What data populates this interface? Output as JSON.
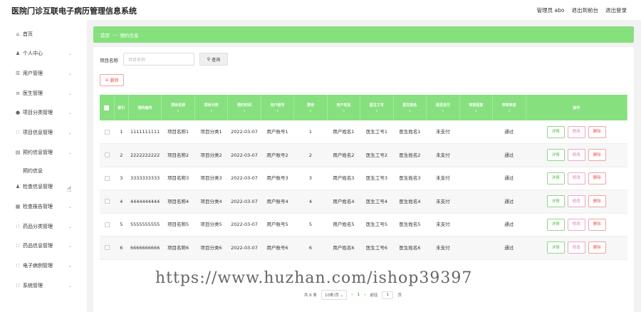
{
  "app": {
    "title": "医院门诊互联电子病历管理信息系统"
  },
  "topnav": {
    "user": "管理员 abo",
    "backend": "退出到前台",
    "logout": "退出登录"
  },
  "sidebar": {
    "items": [
      {
        "icon": "home-icon",
        "glyph": "⌂",
        "label": "首页",
        "arrow": false
      },
      {
        "icon": "user-icon",
        "glyph": "♟",
        "label": "个人中心",
        "arrow": true
      },
      {
        "icon": "users-icon",
        "glyph": "☰",
        "label": "用户管理",
        "arrow": true
      },
      {
        "icon": "doctor-icon",
        "glyph": "≡",
        "label": "医生管理",
        "arrow": true
      },
      {
        "icon": "category-icon",
        "glyph": "●",
        "label": "项目分类管理",
        "arrow": true
      },
      {
        "icon": "grid-icon",
        "glyph": "∷",
        "label": "项目信息管理",
        "arrow": true
      },
      {
        "icon": "calendar-icon",
        "glyph": "▤",
        "label": "预约信息管理",
        "arrow": true
      },
      {
        "icon": "exam-icon",
        "glyph": "♟",
        "label": "检查信息管理",
        "arrow": true
      },
      {
        "icon": "report-icon",
        "glyph": "▦",
        "label": "检查报告管理",
        "arrow": true
      },
      {
        "icon": "drug-category-icon",
        "glyph": "∷",
        "label": "药品分类管理",
        "arrow": true
      },
      {
        "icon": "drug-info-icon",
        "glyph": "∷",
        "label": "药品信息管理",
        "arrow": true
      },
      {
        "icon": "record-icon",
        "glyph": "∷",
        "label": "电子病例管理",
        "arrow": true
      },
      {
        "icon": "system-icon",
        "glyph": "∷",
        "label": "系统管理",
        "arrow": true
      }
    ],
    "sub_item": "预约信息"
  },
  "breadcrumb": {
    "home": "首页",
    "sep": "—",
    "current": "预约信息"
  },
  "search": {
    "label": "项目名称",
    "placeholder": "项目名称",
    "button": "查询"
  },
  "delete_button": "删除",
  "table": {
    "headers": [
      "索引",
      "预约编号",
      "项目名称",
      "项目分类",
      "预约时间",
      "用户账号",
      "费用",
      "用户姓名",
      "医生工号",
      "医生姓名",
      "是否支付",
      "审核回复",
      "审核状态",
      "操作"
    ],
    "rows": [
      {
        "idx": "1",
        "code": "1111111111",
        "project": "项目名称1",
        "category": "项目分类1",
        "time": "2022-03-07",
        "account": "用户账号1",
        "fee": "1",
        "uname": "用户姓名1",
        "docid": "医生工号1",
        "docname": "医生姓名1",
        "paid": "未支付",
        "reply": "",
        "status": "通过"
      },
      {
        "idx": "2",
        "code": "2222222222",
        "project": "项目名称2",
        "category": "项目分类2",
        "time": "2022-03-07",
        "account": "用户账号2",
        "fee": "2",
        "uname": "用户姓名2",
        "docid": "医生工号2",
        "docname": "医生姓名2",
        "paid": "未支付",
        "reply": "",
        "status": "通过"
      },
      {
        "idx": "3",
        "code": "3333333333",
        "project": "项目名称3",
        "category": "项目分类3",
        "time": "2022-03-07",
        "account": "用户账号3",
        "fee": "3",
        "uname": "用户姓名3",
        "docid": "医生工号3",
        "docname": "医生姓名3",
        "paid": "未支付",
        "reply": "",
        "status": "通过"
      },
      {
        "idx": "4",
        "code": "4444444444",
        "project": "项目名称4",
        "category": "项目分类4",
        "time": "2022-03-07",
        "account": "用户账号4",
        "fee": "4",
        "uname": "用户姓名4",
        "docid": "医生工号4",
        "docname": "医生姓名4",
        "paid": "未支付",
        "reply": "",
        "status": "通过"
      },
      {
        "idx": "5",
        "code": "5555555555",
        "project": "项目名称5",
        "category": "项目分类5",
        "time": "2022-03-07",
        "account": "用户账号5",
        "fee": "5",
        "uname": "用户姓名5",
        "docid": "医生工号5",
        "docname": "医生姓名5",
        "paid": "未支付",
        "reply": "",
        "status": "通过"
      },
      {
        "idx": "6",
        "code": "6666666666",
        "project": "项目名称6",
        "category": "项目分类6",
        "time": "2022-03-07",
        "account": "用户账号6",
        "fee": "6",
        "uname": "用户姓名6",
        "docid": "医生工号6",
        "docname": "医生姓名6",
        "paid": "未支付",
        "reply": "",
        "status": "通过"
      }
    ],
    "ops": {
      "detail": "详情",
      "edit": "修改",
      "delete": "删除"
    }
  },
  "pager": {
    "total": "共 6 条",
    "page_size": "10条/页",
    "prev": "‹",
    "current": "1",
    "next": "›",
    "goto": "前往",
    "goto_value": "1",
    "page_unit": "页"
  },
  "watermark": "https://www.huzhan.com/ishop39397",
  "colors": {
    "accent": "#86e07e",
    "danger": "#ee5555"
  }
}
